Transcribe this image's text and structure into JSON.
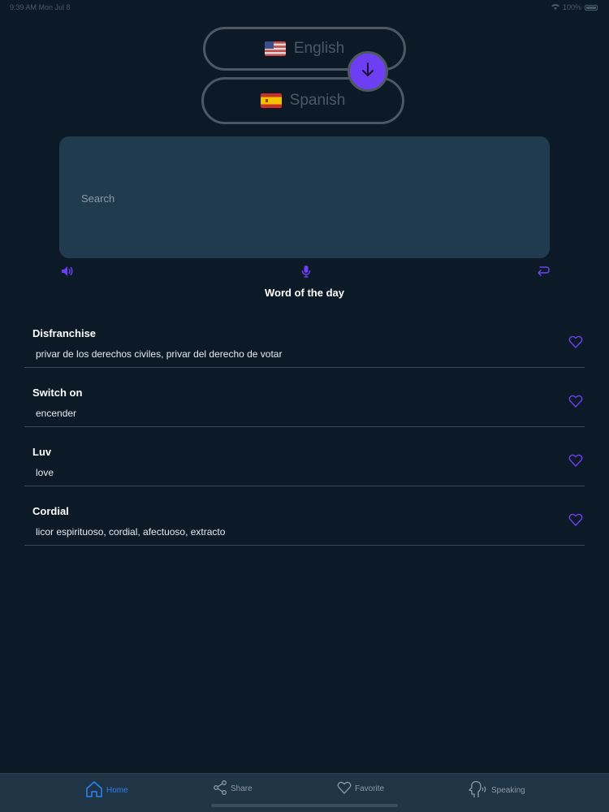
{
  "status_bar": {
    "time": "9:39 AM",
    "date": "Mon Jul 8",
    "battery": "100%"
  },
  "languages": {
    "from": {
      "label": "English",
      "flag": "us-flag-icon"
    },
    "to": {
      "label": "Spanish",
      "flag": "es-flag-icon"
    },
    "swap_icon": "arrow-down-icon"
  },
  "search": {
    "placeholder": "Search",
    "value": ""
  },
  "tools": {
    "speaker": "speaker-icon",
    "mic": "mic-icon",
    "enter": "return-icon"
  },
  "word_of_day": {
    "title": "Word of the day",
    "items": [
      {
        "term": "Disfranchise",
        "translation": "privar de los derechos civiles, privar del derecho de votar"
      },
      {
        "term": "Switch on",
        "translation": "encender"
      },
      {
        "term": "Luv",
        "translation": "love"
      },
      {
        "term": "Cordial",
        "translation": "licor espirituoso, cordial, afectuoso, extracto"
      }
    ]
  },
  "tab_bar": {
    "tabs": [
      {
        "label": "Home",
        "icon": "home-icon",
        "active": true
      },
      {
        "label": "Share",
        "icon": "share-icon",
        "active": false
      },
      {
        "label": "Favorite",
        "icon": "heart-icon",
        "active": false
      },
      {
        "label": "Speaking",
        "icon": "speaking-head-icon",
        "active": false
      }
    ]
  },
  "colors": {
    "background": "#0b1a26",
    "accent": "#6e3ff2",
    "search_bg": "#203a4e",
    "tab_active": "#2f7ff0"
  }
}
